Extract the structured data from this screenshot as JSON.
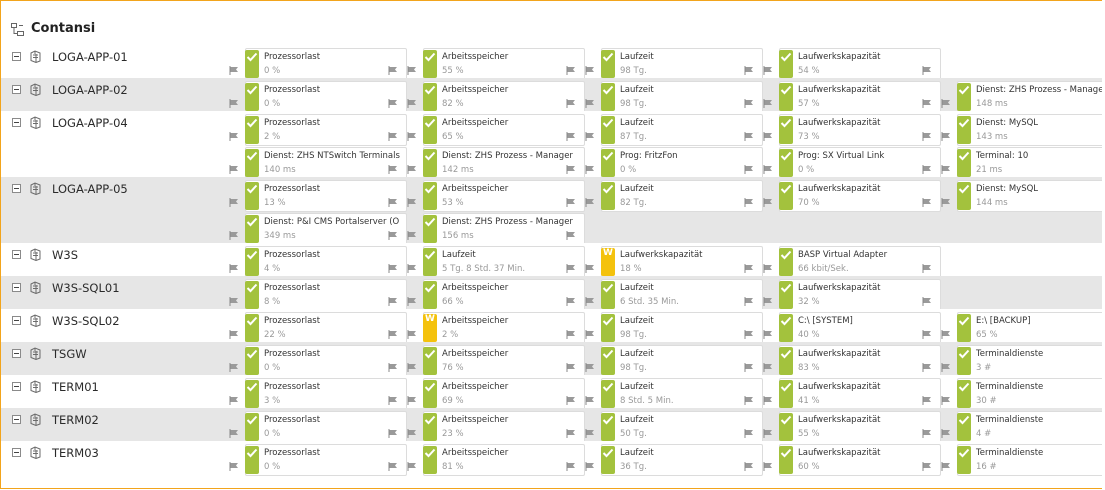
{
  "window": {
    "title": "Contansi"
  },
  "colors": {
    "ok": "#a3c23d",
    "warning": "#f4c20d",
    "border": "#f2a41c",
    "shade": "#e6e6e6"
  },
  "icons": {
    "title": "tree-view-icon",
    "host": "server-icon",
    "sensor_flag": "flag-icon"
  },
  "hosts": [
    {
      "name": "LOGA-APP-01",
      "sensors": [
        {
          "name": "Prozessorlast",
          "value": "0 %",
          "status": "ok"
        },
        {
          "name": "Arbeitsspeicher",
          "value": "55 %",
          "status": "ok"
        },
        {
          "name": "Laufzeit",
          "value": "98 Tg.",
          "status": "ok"
        },
        {
          "name": "Laufwerkskapazität",
          "value": "54 %",
          "status": "ok"
        }
      ]
    },
    {
      "name": "LOGA-APP-02",
      "sensors": [
        {
          "name": "Prozessorlast",
          "value": "0 %",
          "status": "ok"
        },
        {
          "name": "Arbeitsspeicher",
          "value": "82 %",
          "status": "ok"
        },
        {
          "name": "Laufzeit",
          "value": "98 Tg.",
          "status": "ok"
        },
        {
          "name": "Laufwerkskapazität",
          "value": "57 %",
          "status": "ok"
        },
        {
          "name": "Dienst: ZHS Prozess - Manager",
          "value": "148 ms",
          "status": "ok"
        }
      ]
    },
    {
      "name": "LOGA-APP-04",
      "sensors": [
        {
          "name": "Prozessorlast",
          "value": "2 %",
          "status": "ok"
        },
        {
          "name": "Arbeitsspeicher",
          "value": "65 %",
          "status": "ok"
        },
        {
          "name": "Laufzeit",
          "value": "87 Tg.",
          "status": "ok"
        },
        {
          "name": "Laufwerkskapazität",
          "value": "73 %",
          "status": "ok"
        },
        {
          "name": "Dienst: MySQL",
          "value": "143 ms",
          "status": "ok"
        },
        {
          "name": "Dienst: ZHS NTSwitch Terminals",
          "value": "140 ms",
          "status": "ok"
        },
        {
          "name": "Dienst: ZHS Prozess - Manager",
          "value": "142 ms",
          "status": "ok"
        },
        {
          "name": "Prog: FritzFon",
          "value": "0 %",
          "status": "ok"
        },
        {
          "name": "Prog: SX Virtual Link",
          "value": "0 %",
          "status": "ok"
        },
        {
          "name": "Terminal: 10",
          "value": "21 ms",
          "status": "ok"
        }
      ]
    },
    {
      "name": "LOGA-APP-05",
      "sensors": [
        {
          "name": "Prozessorlast",
          "value": "13 %",
          "status": "ok"
        },
        {
          "name": "Arbeitsspeicher",
          "value": "53 %",
          "status": "ok"
        },
        {
          "name": "Laufzeit",
          "value": "82 Tg.",
          "status": "ok"
        },
        {
          "name": "Laufwerkskapazität",
          "value": "70 %",
          "status": "ok"
        },
        {
          "name": "Dienst: MySQL",
          "value": "144 ms",
          "status": "ok"
        },
        {
          "name": "Dienst: P&I CMS Portalserver (O",
          "value": "349 ms",
          "status": "ok"
        },
        {
          "name": "Dienst: ZHS Prozess - Manager",
          "value": "156 ms",
          "status": "ok"
        }
      ]
    },
    {
      "name": "W3S",
      "sensors": [
        {
          "name": "Prozessorlast",
          "value": "4 %",
          "status": "ok"
        },
        {
          "name": "Laufzeit",
          "value": "5 Tg. 8 Std. 37 Min.",
          "status": "ok"
        },
        {
          "name": "Laufwerkskapazität",
          "value": "18 %",
          "status": "warning"
        },
        {
          "name": "BASP Virtual Adapter",
          "value": "66 kbit/Sek.",
          "status": "ok"
        }
      ]
    },
    {
      "name": "W3S-SQL01",
      "sensors": [
        {
          "name": "Prozessorlast",
          "value": "8 %",
          "status": "ok"
        },
        {
          "name": "Arbeitsspeicher",
          "value": "66 %",
          "status": "ok"
        },
        {
          "name": "Laufzeit",
          "value": "6 Std. 35 Min.",
          "status": "ok"
        },
        {
          "name": "Laufwerkskapazität",
          "value": "32 %",
          "status": "ok"
        }
      ]
    },
    {
      "name": "W3S-SQL02",
      "sensors": [
        {
          "name": "Prozessorlast",
          "value": "22 %",
          "status": "ok"
        },
        {
          "name": "Arbeitsspeicher",
          "value": "2 %",
          "status": "warning"
        },
        {
          "name": "Laufzeit",
          "value": "98 Tg.",
          "status": "ok"
        },
        {
          "name": "C:\\ [SYSTEM]",
          "value": "40 %",
          "status": "ok"
        },
        {
          "name": "E:\\ [BACKUP]",
          "value": "65 %",
          "status": "ok"
        }
      ]
    },
    {
      "name": "TSGW",
      "sensors": [
        {
          "name": "Prozessorlast",
          "value": "0 %",
          "status": "ok"
        },
        {
          "name": "Arbeitsspeicher",
          "value": "76 %",
          "status": "ok"
        },
        {
          "name": "Laufzeit",
          "value": "98 Tg.",
          "status": "ok"
        },
        {
          "name": "Laufwerkskapazität",
          "value": "83 %",
          "status": "ok"
        },
        {
          "name": "Terminaldienste",
          "value": "3 #",
          "status": "ok"
        }
      ]
    },
    {
      "name": "TERM01",
      "sensors": [
        {
          "name": "Prozessorlast",
          "value": "3 %",
          "status": "ok"
        },
        {
          "name": "Arbeitsspeicher",
          "value": "69 %",
          "status": "ok"
        },
        {
          "name": "Laufzeit",
          "value": "8 Std. 5 Min.",
          "status": "ok"
        },
        {
          "name": "Laufwerkskapazität",
          "value": "41 %",
          "status": "ok"
        },
        {
          "name": "Terminaldienste",
          "value": "30 #",
          "status": "ok"
        }
      ]
    },
    {
      "name": "TERM02",
      "sensors": [
        {
          "name": "Prozessorlast",
          "value": "0 %",
          "status": "ok"
        },
        {
          "name": "Arbeitsspeicher",
          "value": "23 %",
          "status": "ok"
        },
        {
          "name": "Laufzeit",
          "value": "50 Tg.",
          "status": "ok"
        },
        {
          "name": "Laufwerkskapazität",
          "value": "55 %",
          "status": "ok"
        },
        {
          "name": "Terminaldienste",
          "value": "4 #",
          "status": "ok"
        }
      ]
    },
    {
      "name": "TERM03",
      "sensors": [
        {
          "name": "Prozessorlast",
          "value": "0 %",
          "status": "ok"
        },
        {
          "name": "Arbeitsspeicher",
          "value": "81 %",
          "status": "ok"
        },
        {
          "name": "Laufzeit",
          "value": "36 Tg.",
          "status": "ok"
        },
        {
          "name": "Laufwerkskapazität",
          "value": "60 %",
          "status": "ok"
        },
        {
          "name": "Terminaldienste",
          "value": "16 #",
          "status": "ok"
        }
      ]
    }
  ]
}
